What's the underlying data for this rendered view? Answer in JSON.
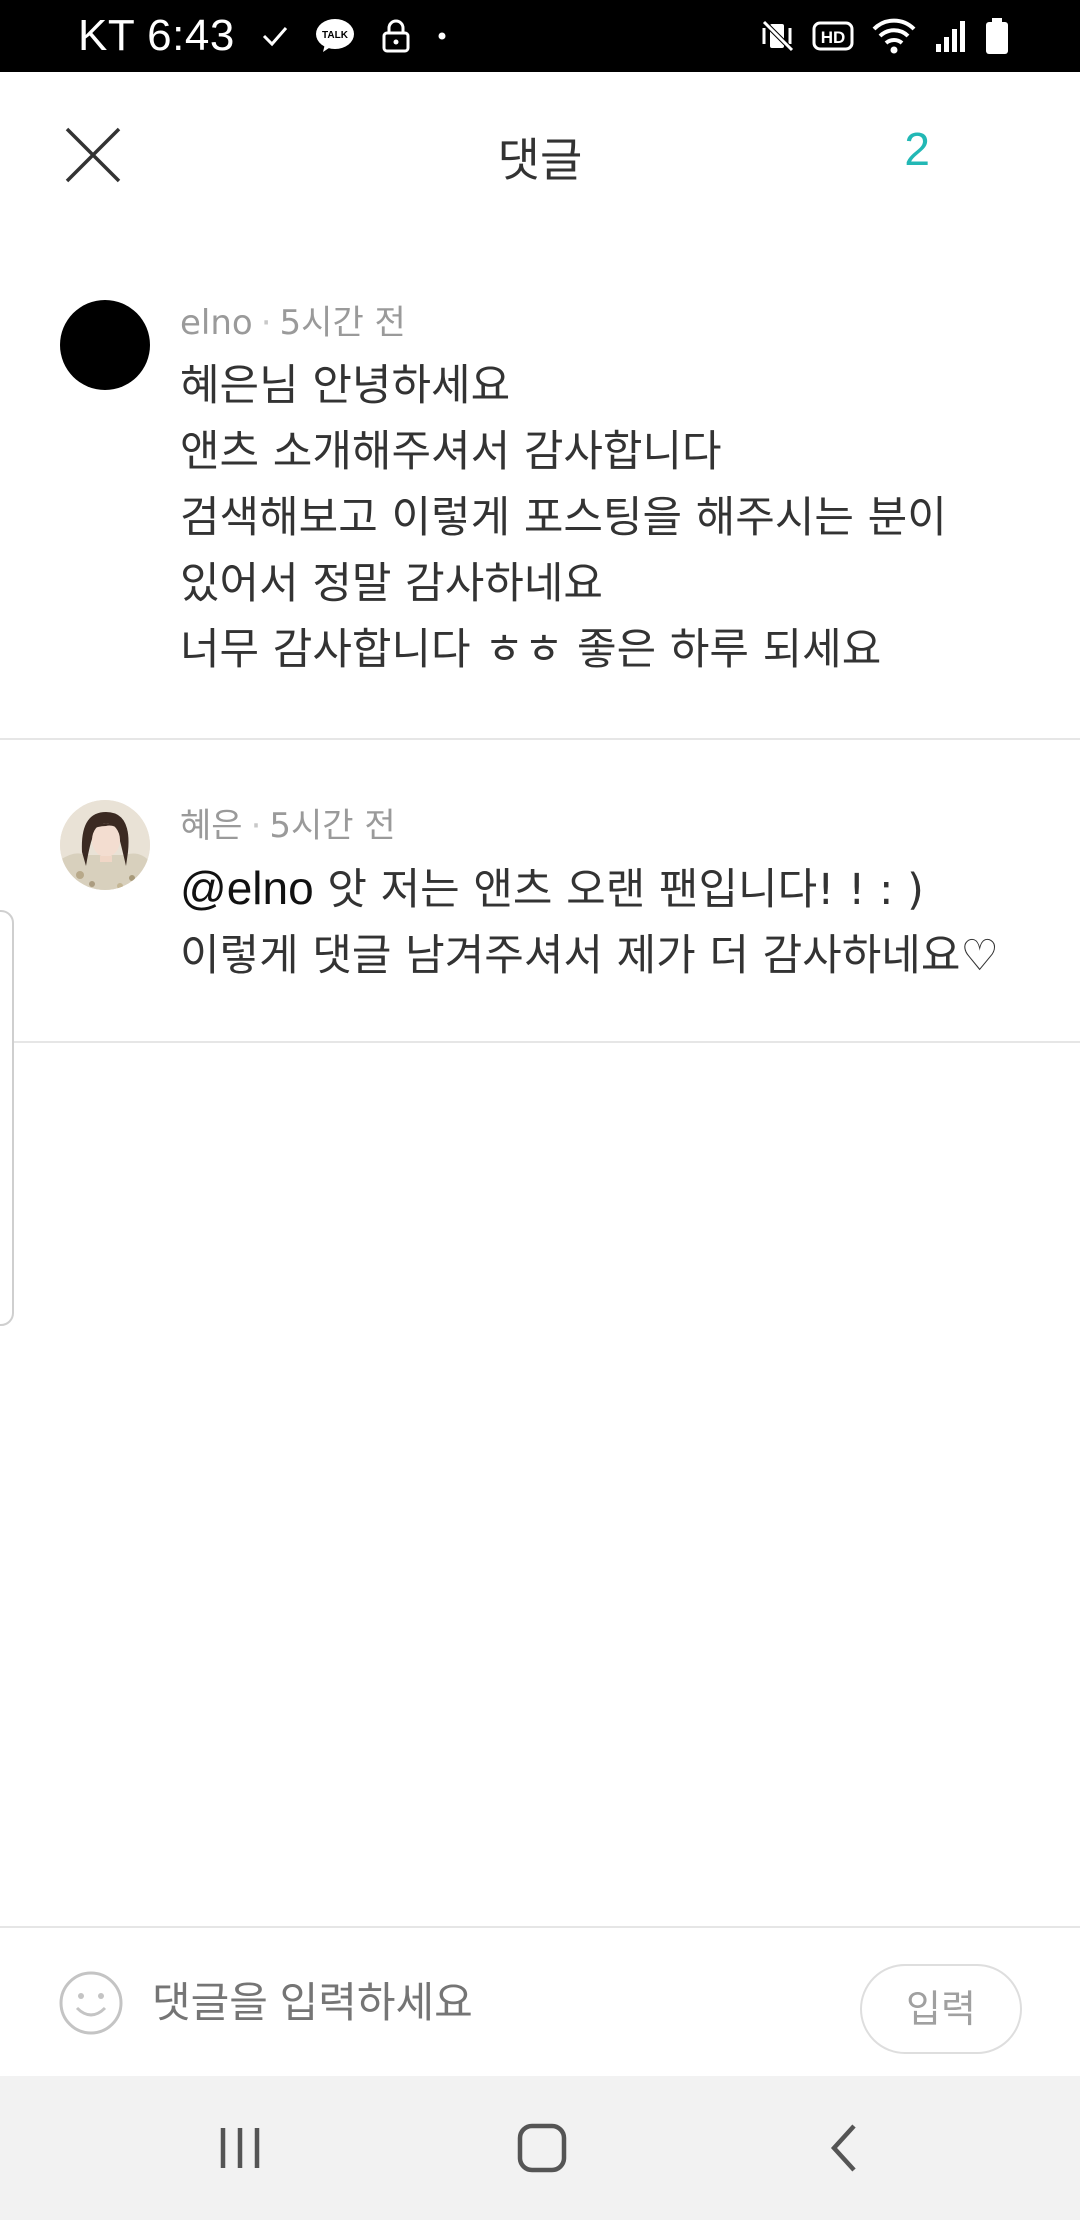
{
  "status_bar": {
    "carrier_time": "KT 6:43",
    "icons_left": [
      "check-icon",
      "kakaotalk-icon",
      "lock-icon",
      "dot-icon"
    ],
    "icons_right": [
      "vibrate-icon",
      "hd-icon",
      "wifi-icon",
      "signal-icon",
      "battery-icon"
    ]
  },
  "header": {
    "title": "댓글",
    "count": "2",
    "accent_color": "#22b8b5"
  },
  "comments": [
    {
      "author": "elno",
      "time": "5시간 전",
      "lines": [
        "혜은님 안녕하세요",
        "앤츠 소개해주셔서 감사합니다",
        "검색해보고 이렇게 포스팅을 해주시는 분이",
        "있어서 정말 감사하네요",
        "너무 감사합니다 ㅎㅎ 좋은 하루 되세요"
      ]
    },
    {
      "author": "혜은",
      "time": "5시간 전",
      "mention": "@elno",
      "line1_rest": " 앗 저는 앤츠 오랜 팬입니다! ! : )",
      "line2": "이렇게 댓글 남겨주셔서 제가 더 감사하네요♡"
    }
  ],
  "input_bar": {
    "placeholder": "댓글을 입력하세요",
    "submit_label": "입력"
  },
  "nav_bar": {
    "buttons": [
      "recents-icon",
      "home-icon",
      "back-icon"
    ]
  }
}
